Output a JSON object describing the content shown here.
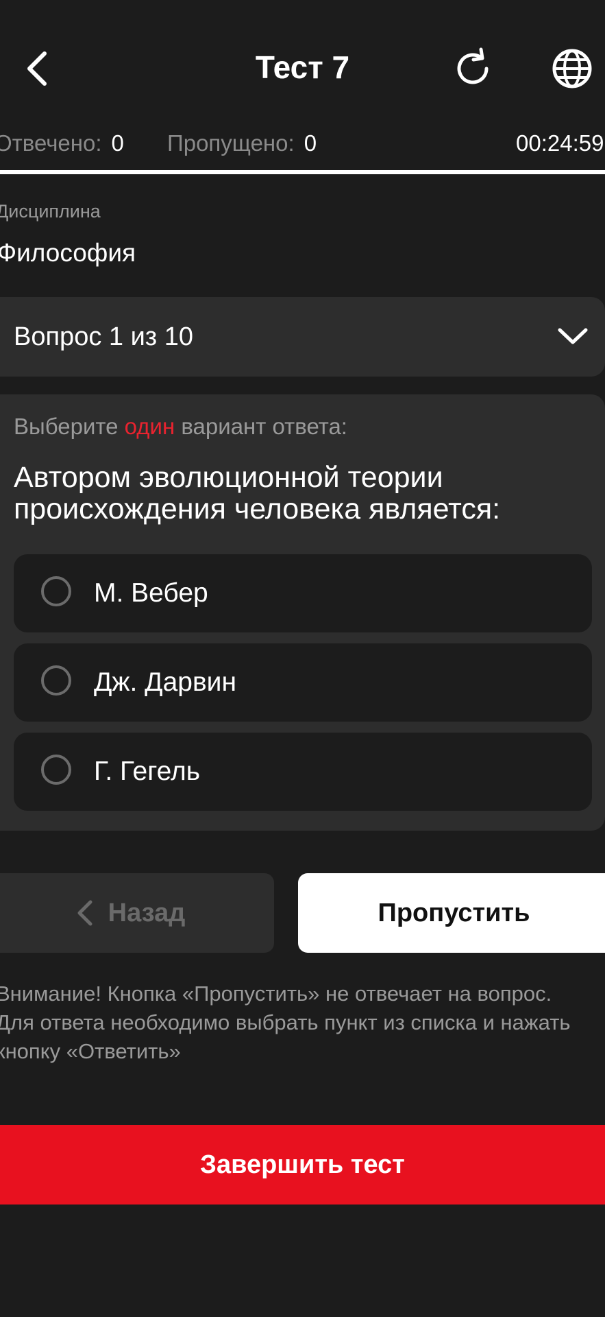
{
  "header": {
    "title": "Тест 7",
    "back_icon": "chevron-left-icon",
    "refresh_icon": "refresh-icon",
    "language_icon": "globe-icon"
  },
  "stats": {
    "answered_label": "Отвечено:",
    "answered_value": "0",
    "skipped_label": "Пропущено:",
    "skipped_value": "0",
    "timer": "00:24:59",
    "progress_fraction": 1.0
  },
  "discipline": {
    "label": "Дисциплина",
    "value": "Философия"
  },
  "question_selector": {
    "label": "Вопрос 1 из 10",
    "icon": "chevron-down-icon"
  },
  "question": {
    "instruction_before": "Выберите ",
    "instruction_highlight": "один",
    "instruction_after": " вариант ответа:",
    "text": "Автором эволюционной теории происхождения человека является:",
    "options": [
      {
        "label": "М. Вебер",
        "selected": false
      },
      {
        "label": "Дж. Дарвин",
        "selected": false
      },
      {
        "label": "Г. Гегель",
        "selected": false
      }
    ]
  },
  "navigation": {
    "back_label": "Назад",
    "skip_label": "Пропустить"
  },
  "notice": "Внимание! Кнопка «Пропустить» не отвечает на вопрос. Для ответа необходимо выбрать пункт из списка и нажать кнопку «Ответить»",
  "finish_label": "Завершить тест",
  "colors": {
    "background": "#1c1c1c",
    "card": "#2d2d2d",
    "accent_red": "#e8111f",
    "highlight_red": "#e8232f",
    "muted_text": "#9a9a9a"
  }
}
